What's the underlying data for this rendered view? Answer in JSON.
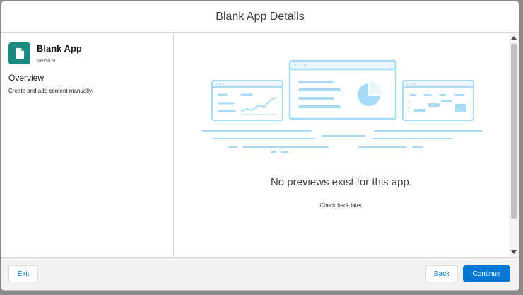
{
  "modal": {
    "title": "Blank App Details"
  },
  "app": {
    "name": "Blank App",
    "subtitle": "Version",
    "icon": "document-icon",
    "icon_color": "#1b8a80"
  },
  "overview": {
    "heading": "Overview",
    "text": "Create and add content manually."
  },
  "empty_state": {
    "title": "No previews exist for this app.",
    "subtitle": "Check back later."
  },
  "footer": {
    "exit_label": "Exit",
    "back_label": "Back",
    "continue_label": "Continue"
  },
  "colors": {
    "primary": "#0176d3",
    "illustration_stroke": "#a8dbf5",
    "illustration_fill": "#eaf6fd"
  }
}
